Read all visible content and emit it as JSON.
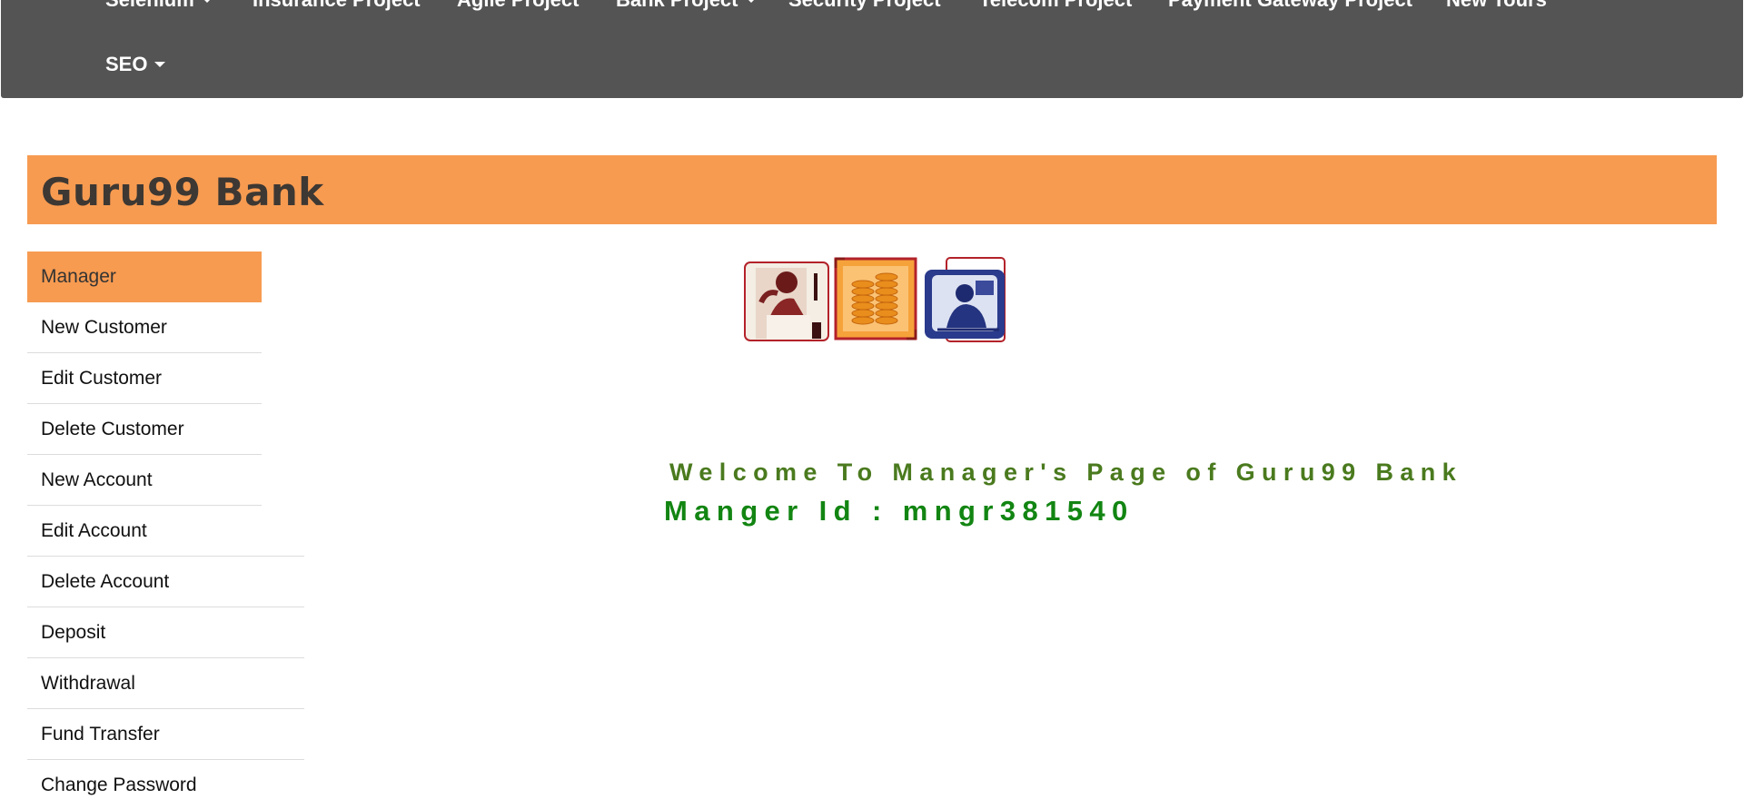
{
  "navbar": {
    "items_top": [
      {
        "label": "Selenium",
        "has_caret": true
      },
      {
        "label": "Insurance Project",
        "has_caret": false
      },
      {
        "label": "Agile Project",
        "has_caret": false
      },
      {
        "label": "Bank Project",
        "has_caret": true
      },
      {
        "label": "Security Project",
        "has_caret": false
      },
      {
        "label": "Telecom Project",
        "has_caret": false
      },
      {
        "label": "Payment Gateway Project",
        "has_caret": false
      },
      {
        "label": "New Tours",
        "has_caret": false
      }
    ],
    "seo": {
      "label": "SEO",
      "has_caret": true
    }
  },
  "banner": {
    "title": "Guru99 Bank"
  },
  "sidebar": {
    "items": [
      {
        "label": "Manager",
        "active": true
      },
      {
        "label": "New Customer"
      },
      {
        "label": "Edit Customer"
      },
      {
        "label": "Delete Customer"
      },
      {
        "label": "New Account"
      },
      {
        "label": "Edit Account"
      },
      {
        "label": "Delete Account"
      },
      {
        "label": "Deposit"
      },
      {
        "label": "Withdrawal"
      },
      {
        "label": "Fund Transfer"
      },
      {
        "label": "Change Password"
      }
    ]
  },
  "logos": [
    {
      "icon": "man-on-phone-icon"
    },
    {
      "icon": "coin-stack-icon"
    },
    {
      "icon": "woman-at-computer-icon"
    }
  ],
  "main": {
    "welcome_text": "Welcome To Manager's Page of Guru99 Bank",
    "manager_id_text": "Manger Id : mngr381540"
  },
  "colors": {
    "navbar": "#545454",
    "accent_orange": "#f79b51",
    "welcome_green": "#4a7a1e",
    "id_green": "#128512"
  }
}
